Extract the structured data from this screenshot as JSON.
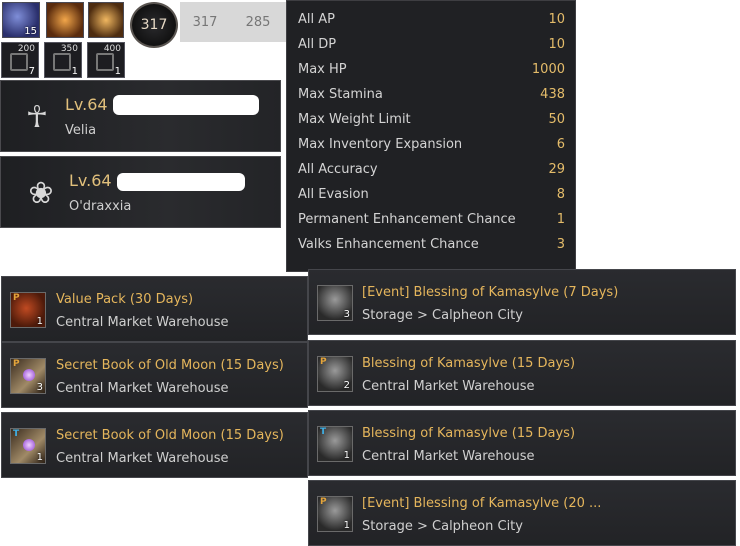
{
  "icons_strip": {
    "buff1_count": "15",
    "level_circle": "317",
    "faded_level": "317",
    "faded_value": "285",
    "slots": [
      {
        "top": "200",
        "bottom": "7"
      },
      {
        "top": "350",
        "bottom": "1"
      },
      {
        "top": "400",
        "bottom": "1"
      }
    ]
  },
  "characters": [
    {
      "level": "Lv.64",
      "name": "Velia"
    },
    {
      "level": "Lv.64",
      "name": "O'draxxia"
    }
  ],
  "stats": [
    {
      "label": "All AP",
      "value": "10"
    },
    {
      "label": "All DP",
      "value": "10"
    },
    {
      "label": "Max HP",
      "value": "1000"
    },
    {
      "label": "Max Stamina",
      "value": "438"
    },
    {
      "label": "Max Weight Limit",
      "value": "50"
    },
    {
      "label": "Max Inventory Expansion",
      "value": "6"
    },
    {
      "label": "All Accuracy",
      "value": "29"
    },
    {
      "label": "All Evasion",
      "value": "8"
    },
    {
      "label": "Permanent Enhancement Chance",
      "value": "1"
    },
    {
      "label": "Valks Enhancement Chance",
      "value": "3"
    }
  ],
  "items_left": [
    {
      "badge": "P",
      "count": "1",
      "title": "Value Pack (30 Days)",
      "location": "Central Market Warehouse"
    },
    {
      "badge": "P",
      "count": "3",
      "title": "Secret Book of Old Moon (15 Days)",
      "location": "Central Market Warehouse"
    },
    {
      "badge": "T",
      "count": "1",
      "title": "Secret Book of Old Moon (15 Days)",
      "location": "Central Market Warehouse"
    }
  ],
  "items_right": [
    {
      "badge": "",
      "count": "3",
      "title": "[Event] Blessing of Kamasylve (7 Days)",
      "location": "Storage > Calpheon City"
    },
    {
      "badge": "P",
      "count": "2",
      "title": "Blessing of Kamasylve (15 Days)",
      "location": "Central Market Warehouse"
    },
    {
      "badge": "T",
      "count": "1",
      "title": "Blessing of Kamasylve (15 Days)",
      "location": "Central Market Warehouse"
    },
    {
      "badge": "P",
      "count": "1",
      "title": "[Event] Blessing of Kamasylve (20 ...",
      "location": "Storage > Calpheon City"
    }
  ]
}
